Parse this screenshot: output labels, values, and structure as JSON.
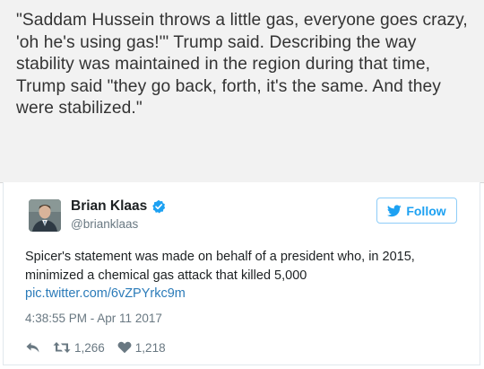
{
  "quote": {
    "text": "\"Saddam Hussein throws a little gas, everyone goes crazy, 'oh he's using gas!'\" Trump said. Describing the way stability was maintained in the region during that time, Trump said \"they go back, forth, it's the same. And they were stabilized.\""
  },
  "tweet": {
    "display_name": "Brian Klaas",
    "verified": true,
    "handle": "@brianklaas",
    "follow_label": "Follow",
    "text": "Spicer's statement was made on behalf of a president who, in 2015, minimized a chemical gas attack that killed 5,000",
    "link": "pic.twitter.com/6vZPYrkc9m",
    "timestamp": "4:38:55 PM - Apr 11 2017",
    "retweet_count": "1,266",
    "like_count": "1,218",
    "icons": {
      "avatar": "avatar-photo",
      "verified": "verified-badge-icon",
      "follow": "twitter-bird-icon",
      "reply": "reply-icon",
      "retweet": "retweet-icon",
      "like": "heart-icon"
    },
    "colors": {
      "accent": "#1da1f2",
      "link": "#2b7bb9",
      "muted": "#697882",
      "text": "#1c2022"
    }
  }
}
